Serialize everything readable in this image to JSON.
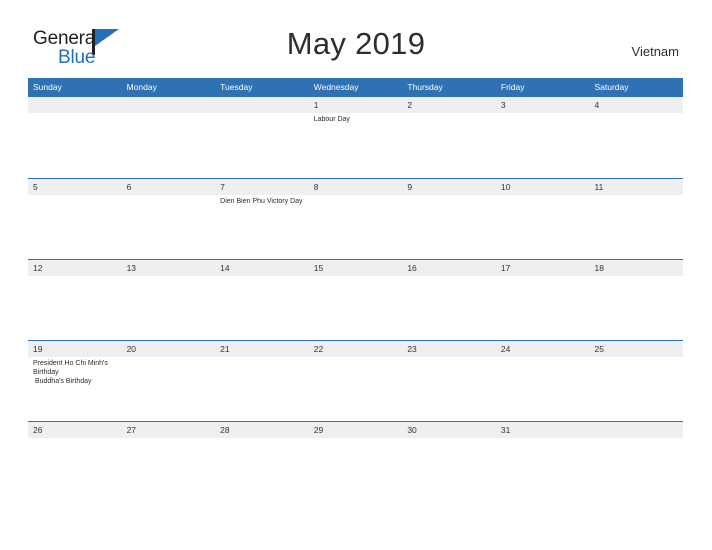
{
  "header": {
    "logo": {
      "word_one": "General",
      "word_two": "Blue",
      "flag_icon": "flag-triangle-icon"
    },
    "title": "May 2019",
    "country": "Vietnam"
  },
  "colors": {
    "header_blue": "#2e71b4",
    "logo_blue": "#2470b8",
    "band_gray": "#efefef",
    "text_dark": "#333333"
  },
  "calendar": {
    "weekdays": [
      "Sunday",
      "Monday",
      "Tuesday",
      "Wednesday",
      "Thursday",
      "Friday",
      "Saturday"
    ],
    "weeks": [
      {
        "days": [
          {
            "num": "",
            "events": []
          },
          {
            "num": "",
            "events": []
          },
          {
            "num": "",
            "events": []
          },
          {
            "num": "1",
            "events": [
              "Labour Day"
            ]
          },
          {
            "num": "2",
            "events": []
          },
          {
            "num": "3",
            "events": []
          },
          {
            "num": "4",
            "events": []
          }
        ]
      },
      {
        "days": [
          {
            "num": "5",
            "events": []
          },
          {
            "num": "6",
            "events": []
          },
          {
            "num": "7",
            "events": [
              "Dien Bien Phu Victory Day"
            ]
          },
          {
            "num": "8",
            "events": []
          },
          {
            "num": "9",
            "events": []
          },
          {
            "num": "10",
            "events": []
          },
          {
            "num": "11",
            "events": []
          }
        ]
      },
      {
        "days": [
          {
            "num": "12",
            "events": []
          },
          {
            "num": "13",
            "events": []
          },
          {
            "num": "14",
            "events": []
          },
          {
            "num": "15",
            "events": []
          },
          {
            "num": "16",
            "events": []
          },
          {
            "num": "17",
            "events": []
          },
          {
            "num": "18",
            "events": []
          }
        ]
      },
      {
        "days": [
          {
            "num": "19",
            "events": [
              "President Ho Chi Minh's Birthday",
              " Buddha's Birthday"
            ]
          },
          {
            "num": "20",
            "events": []
          },
          {
            "num": "21",
            "events": []
          },
          {
            "num": "22",
            "events": []
          },
          {
            "num": "23",
            "events": []
          },
          {
            "num": "24",
            "events": []
          },
          {
            "num": "25",
            "events": []
          }
        ]
      },
      {
        "days": [
          {
            "num": "26",
            "events": []
          },
          {
            "num": "27",
            "events": []
          },
          {
            "num": "28",
            "events": []
          },
          {
            "num": "29",
            "events": []
          },
          {
            "num": "30",
            "events": []
          },
          {
            "num": "31",
            "events": []
          },
          {
            "num": "",
            "events": []
          }
        ]
      }
    ]
  }
}
